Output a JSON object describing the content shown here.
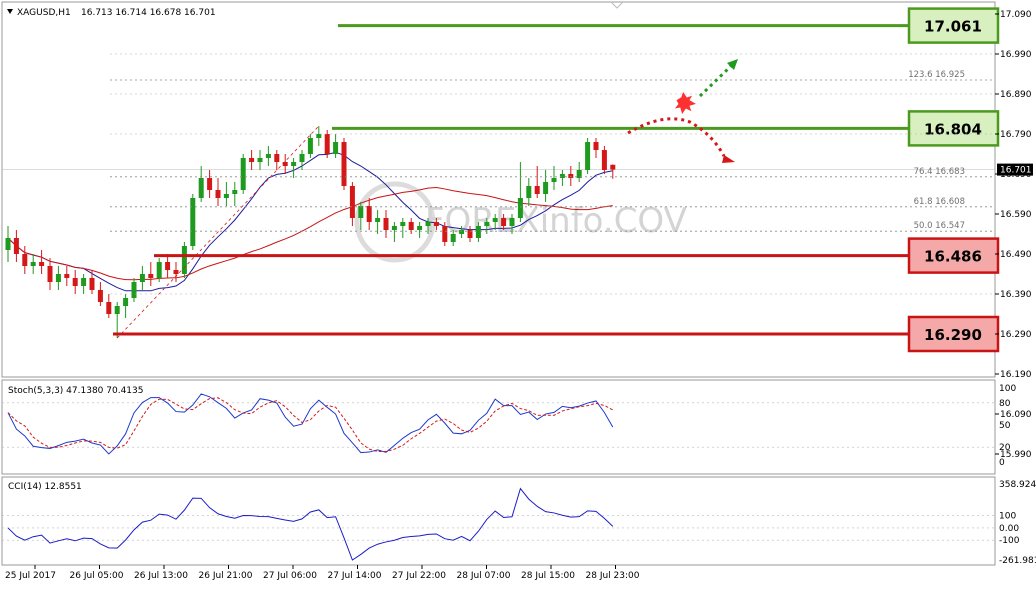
{
  "colors": {
    "bull": "#1e9a1e",
    "bear": "#d41818",
    "ma_fast": "#1c1c9e",
    "ma_slow": "#c81414",
    "resistance": "#4a9a1e",
    "support": "#c81414",
    "res_box": "#d8f0c0",
    "sup_box": "#f4a8a8",
    "stoch_main": "#1c38d0",
    "stoch_signal": "#d21c1c",
    "cci": "#1c1cc8"
  },
  "header": {
    "symbol": "XAGUSD,H1",
    "ohlc": "16.713 16.714 16.678 16.701"
  },
  "watermark": "FOREXinfo.COV",
  "price_axis": {
    "ticks": [
      "17.090",
      "16.990",
      "16.890",
      "16.790",
      "16.690",
      "16.590",
      "16.490",
      "16.390",
      "16.290",
      "16.190",
      "16.090",
      "15.990"
    ],
    "current": "16.701"
  },
  "levels": {
    "r1": "17.061",
    "r2": "16.804",
    "s1": "16.486",
    "s2": "16.290"
  },
  "fib_labels": {
    "f1": "123.6  16.925",
    "f2": "76.4  16.683",
    "f3": "61.8  16.608",
    "f4": "50.0  16.547"
  },
  "stoch": {
    "label": "Stoch(5,3,3) 47.1380 70.4135",
    "ticks": [
      "100",
      "80",
      "50",
      "20",
      "0"
    ]
  },
  "cci": {
    "label": "CCI(14) 12.8551",
    "ticks": [
      "358.9244",
      "100",
      "0.00",
      "-100",
      "-261.9817"
    ]
  },
  "time_axis": [
    "25 Jul 2017",
    "26 Jul 05:00",
    "26 Jul 13:00",
    "26 Jul 21:00",
    "27 Jul 06:00",
    "27 Jul 14:00",
    "27 Jul 22:00",
    "28 Jul 07:00",
    "28 Jul 15:00",
    "28 Jul 23:00"
  ],
  "chart_data": {
    "type": "candlestick",
    "symbol": "XAGUSD",
    "timeframe": "H1",
    "y_range": [
      15.97,
      17.1
    ],
    "candles": [
      {
        "o": 16.5,
        "h": 16.56,
        "l": 16.47,
        "c": 16.53
      },
      {
        "o": 16.53,
        "h": 16.55,
        "l": 16.47,
        "c": 16.49
      },
      {
        "o": 16.49,
        "h": 16.51,
        "l": 16.44,
        "c": 16.46
      },
      {
        "o": 16.46,
        "h": 16.49,
        "l": 16.44,
        "c": 16.47
      },
      {
        "o": 16.47,
        "h": 16.5,
        "l": 16.44,
        "c": 16.46
      },
      {
        "o": 16.46,
        "h": 16.48,
        "l": 16.4,
        "c": 16.42
      },
      {
        "o": 16.42,
        "h": 16.46,
        "l": 16.4,
        "c": 16.44
      },
      {
        "o": 16.44,
        "h": 16.46,
        "l": 16.41,
        "c": 16.43
      },
      {
        "o": 16.43,
        "h": 16.45,
        "l": 16.39,
        "c": 16.41
      },
      {
        "o": 16.41,
        "h": 16.44,
        "l": 16.39,
        "c": 16.43
      },
      {
        "o": 16.43,
        "h": 16.45,
        "l": 16.39,
        "c": 16.4
      },
      {
        "o": 16.4,
        "h": 16.42,
        "l": 16.36,
        "c": 16.37
      },
      {
        "o": 16.37,
        "h": 16.39,
        "l": 16.33,
        "c": 16.34
      },
      {
        "o": 16.34,
        "h": 16.37,
        "l": 16.28,
        "c": 16.36
      },
      {
        "o": 16.36,
        "h": 16.39,
        "l": 16.33,
        "c": 16.38
      },
      {
        "o": 16.38,
        "h": 16.43,
        "l": 16.37,
        "c": 16.42
      },
      {
        "o": 16.42,
        "h": 16.46,
        "l": 16.4,
        "c": 16.44
      },
      {
        "o": 16.44,
        "h": 16.47,
        "l": 16.41,
        "c": 16.43
      },
      {
        "o": 16.43,
        "h": 16.48,
        "l": 16.42,
        "c": 16.47
      },
      {
        "o": 16.47,
        "h": 16.49,
        "l": 16.43,
        "c": 16.45
      },
      {
        "o": 16.45,
        "h": 16.47,
        "l": 16.42,
        "c": 16.44
      },
      {
        "o": 16.44,
        "h": 16.52,
        "l": 16.43,
        "c": 16.51
      },
      {
        "o": 16.51,
        "h": 16.64,
        "l": 16.5,
        "c": 16.63
      },
      {
        "o": 16.63,
        "h": 16.71,
        "l": 16.62,
        "c": 16.68
      },
      {
        "o": 16.68,
        "h": 16.7,
        "l": 16.63,
        "c": 16.65
      },
      {
        "o": 16.65,
        "h": 16.68,
        "l": 16.61,
        "c": 16.63
      },
      {
        "o": 16.63,
        "h": 16.67,
        "l": 16.61,
        "c": 16.64
      },
      {
        "o": 16.64,
        "h": 16.67,
        "l": 16.61,
        "c": 16.65
      },
      {
        "o": 16.65,
        "h": 16.74,
        "l": 16.64,
        "c": 16.73
      },
      {
        "o": 16.73,
        "h": 16.75,
        "l": 16.7,
        "c": 16.72
      },
      {
        "o": 16.72,
        "h": 16.75,
        "l": 16.7,
        "c": 16.73
      },
      {
        "o": 16.73,
        "h": 16.76,
        "l": 16.71,
        "c": 16.74
      },
      {
        "o": 16.74,
        "h": 16.75,
        "l": 16.7,
        "c": 16.72
      },
      {
        "o": 16.72,
        "h": 16.74,
        "l": 16.69,
        "c": 16.71
      },
      {
        "o": 16.71,
        "h": 16.73,
        "l": 16.68,
        "c": 16.72
      },
      {
        "o": 16.72,
        "h": 16.75,
        "l": 16.7,
        "c": 16.74
      },
      {
        "o": 16.74,
        "h": 16.79,
        "l": 16.73,
        "c": 16.78
      },
      {
        "o": 16.78,
        "h": 16.81,
        "l": 16.76,
        "c": 16.79
      },
      {
        "o": 16.79,
        "h": 16.8,
        "l": 16.73,
        "c": 16.74
      },
      {
        "o": 16.74,
        "h": 16.79,
        "l": 16.73,
        "c": 16.77
      },
      {
        "o": 16.77,
        "h": 16.78,
        "l": 16.65,
        "c": 16.66
      },
      {
        "o": 16.66,
        "h": 16.67,
        "l": 16.56,
        "c": 16.58
      },
      {
        "o": 16.58,
        "h": 16.62,
        "l": 16.55,
        "c": 16.61
      },
      {
        "o": 16.61,
        "h": 16.63,
        "l": 16.55,
        "c": 16.57
      },
      {
        "o": 16.57,
        "h": 16.6,
        "l": 16.54,
        "c": 16.58
      },
      {
        "o": 16.58,
        "h": 16.6,
        "l": 16.53,
        "c": 16.55
      },
      {
        "o": 16.55,
        "h": 16.57,
        "l": 16.52,
        "c": 16.56
      },
      {
        "o": 16.56,
        "h": 16.58,
        "l": 16.53,
        "c": 16.57
      },
      {
        "o": 16.57,
        "h": 16.58,
        "l": 16.54,
        "c": 16.55
      },
      {
        "o": 16.55,
        "h": 16.57,
        "l": 16.53,
        "c": 16.56
      },
      {
        "o": 16.56,
        "h": 16.58,
        "l": 16.54,
        "c": 16.57
      },
      {
        "o": 16.57,
        "h": 16.58,
        "l": 16.55,
        "c": 16.56
      },
      {
        "o": 16.56,
        "h": 16.57,
        "l": 16.51,
        "c": 16.52
      },
      {
        "o": 16.52,
        "h": 16.55,
        "l": 16.51,
        "c": 16.54
      },
      {
        "o": 16.54,
        "h": 16.56,
        "l": 16.53,
        "c": 16.55
      },
      {
        "o": 16.55,
        "h": 16.56,
        "l": 16.52,
        "c": 16.53
      },
      {
        "o": 16.53,
        "h": 16.57,
        "l": 16.52,
        "c": 16.56
      },
      {
        "o": 16.56,
        "h": 16.58,
        "l": 16.54,
        "c": 16.57
      },
      {
        "o": 16.57,
        "h": 16.59,
        "l": 16.55,
        "c": 16.58
      },
      {
        "o": 16.58,
        "h": 16.59,
        "l": 16.55,
        "c": 16.56
      },
      {
        "o": 16.56,
        "h": 16.59,
        "l": 16.54,
        "c": 16.58
      },
      {
        "o": 16.58,
        "h": 16.72,
        "l": 16.57,
        "c": 16.63
      },
      {
        "o": 16.63,
        "h": 16.68,
        "l": 16.61,
        "c": 16.66
      },
      {
        "o": 16.66,
        "h": 16.71,
        "l": 16.63,
        "c": 16.64
      },
      {
        "o": 16.64,
        "h": 16.7,
        "l": 16.62,
        "c": 16.67
      },
      {
        "o": 16.67,
        "h": 16.71,
        "l": 16.65,
        "c": 16.68
      },
      {
        "o": 16.68,
        "h": 16.7,
        "l": 16.66,
        "c": 16.69
      },
      {
        "o": 16.69,
        "h": 16.71,
        "l": 16.66,
        "c": 16.68
      },
      {
        "o": 16.68,
        "h": 16.72,
        "l": 16.67,
        "c": 16.7
      },
      {
        "o": 16.7,
        "h": 16.78,
        "l": 16.69,
        "c": 16.77
      },
      {
        "o": 16.77,
        "h": 16.78,
        "l": 16.73,
        "c": 16.75
      },
      {
        "o": 16.75,
        "h": 16.76,
        "l": 16.69,
        "c": 16.7
      },
      {
        "o": 16.713,
        "h": 16.714,
        "l": 16.678,
        "c": 16.701
      }
    ],
    "fibonacci": [
      {
        "level": "123.6",
        "price": 16.925
      },
      {
        "level": "76.4",
        "price": 16.683
      },
      {
        "level": "61.8",
        "price": 16.608
      },
      {
        "level": "50.0",
        "price": 16.547
      }
    ],
    "horizontal_levels": [
      {
        "price": 17.061,
        "type": "resistance"
      },
      {
        "price": 16.804,
        "type": "resistance"
      },
      {
        "price": 16.486,
        "type": "support"
      },
      {
        "price": 16.29,
        "type": "support"
      }
    ],
    "indicators": {
      "stochastic": {
        "params": "5,3,3",
        "main": 47.138,
        "signal": 70.4135,
        "y_range": [
          0,
          100
        ]
      },
      "cci": {
        "period": 14,
        "value": 12.8551,
        "y_range": [
          -261.9817,
          358.9244
        ]
      }
    }
  }
}
